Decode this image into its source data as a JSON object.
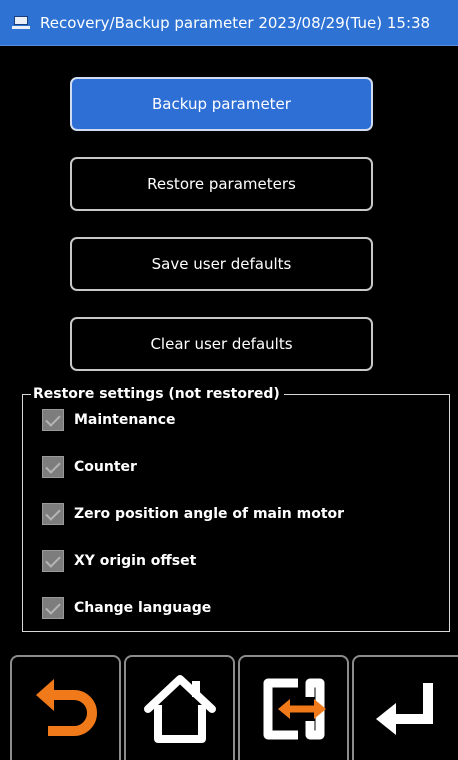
{
  "header": {
    "title": "Recovery/Backup parameter 2023/08/29(Tue) 15:38",
    "icon": "monitor-icon"
  },
  "actions": [
    {
      "label": "Backup parameter",
      "active": true
    },
    {
      "label": "Restore parameters",
      "active": false
    },
    {
      "label": "Save user defaults",
      "active": false
    },
    {
      "label": "Clear user defaults",
      "active": false
    }
  ],
  "restore_settings": {
    "legend": "Restore settings (not restored)",
    "items": [
      {
        "label": "Maintenance",
        "checked": true
      },
      {
        "label": "Counter",
        "checked": true
      },
      {
        "label": "Zero position angle of main motor",
        "checked": true
      },
      {
        "label": "XY origin offset",
        "checked": true
      },
      {
        "label": "Change language",
        "checked": true
      }
    ]
  },
  "toolbar": {
    "buttons": [
      {
        "icon": "back-arrow-icon"
      },
      {
        "icon": "home-icon"
      },
      {
        "icon": "transfer-icon"
      },
      {
        "icon": "enter-icon"
      }
    ]
  },
  "colors": {
    "header_bg": "#2e73d4",
    "active_button": "#2e6fd6",
    "accent_orange": "#f07a1a",
    "background": "#000000"
  }
}
